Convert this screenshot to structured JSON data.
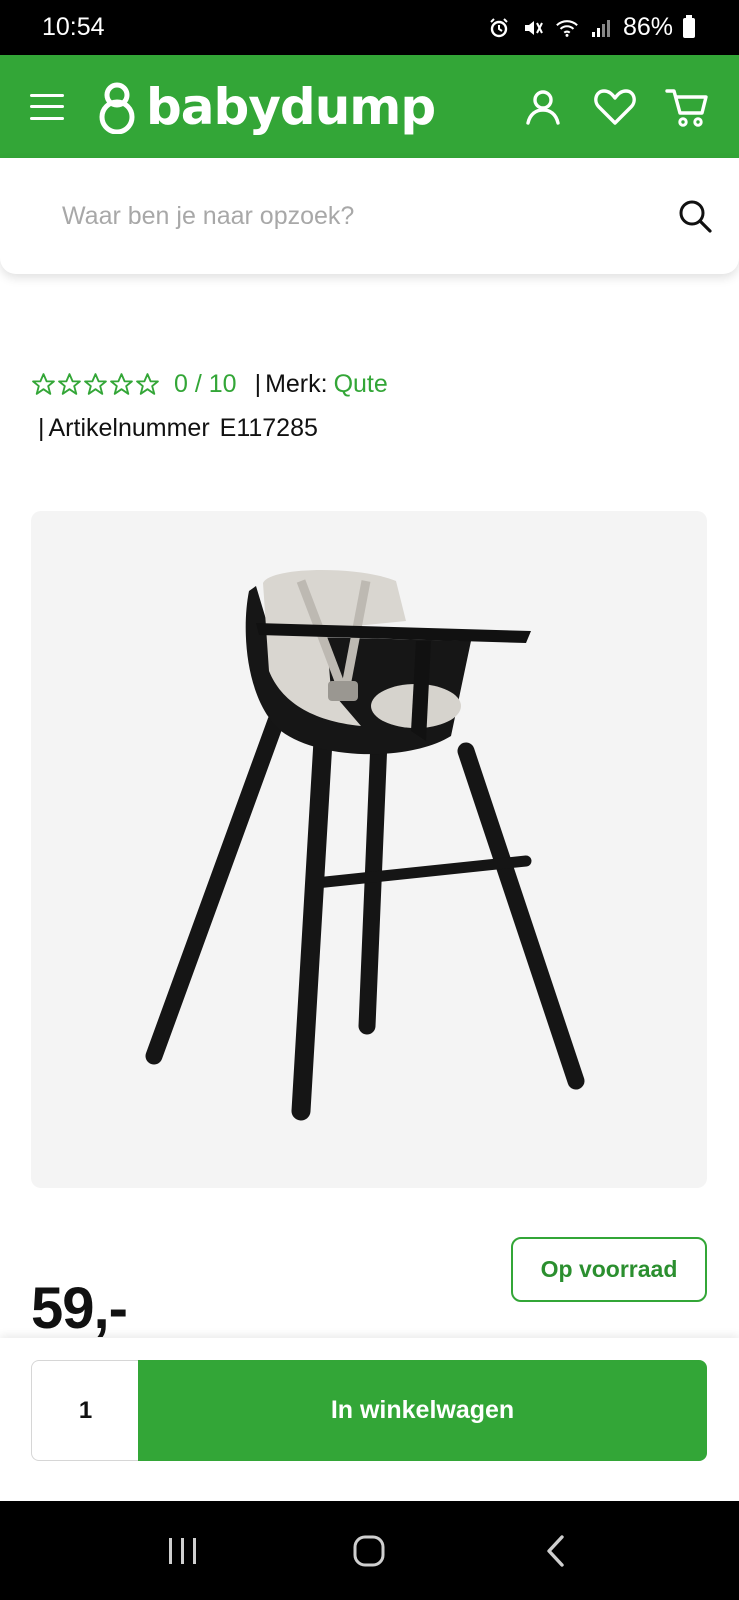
{
  "status_bar": {
    "time": "10:54",
    "battery": "86%",
    "icons": [
      "alarm-icon",
      "mute-icon",
      "wifi-icon",
      "signal-icon",
      "battery-icon"
    ]
  },
  "header": {
    "logo_text": "babydump",
    "menu_icon": "hamburger-icon",
    "actions": [
      "account-icon",
      "heart-icon",
      "cart-icon"
    ],
    "bg_color": "#33a637"
  },
  "search": {
    "placeholder": "Waar ben je naar opzoek?",
    "icon": "search-icon"
  },
  "product": {
    "rating": {
      "stars_filled": 0,
      "stars_total": 5,
      "score_text": "0 / 10"
    },
    "brand_label": "Merk:",
    "brand": "Qute",
    "article_label": "Artikelnummer",
    "article_number": "E117285",
    "stock_status": "Op voorraad",
    "price": "59,-"
  },
  "purchase": {
    "quantity": "1",
    "add_to_cart_label": "In winkelwagen"
  },
  "nav_bar": {
    "buttons": [
      "recent-apps-icon",
      "home-icon",
      "back-icon"
    ]
  },
  "colors": {
    "brand_green": "#33a637",
    "text": "#111111",
    "image_bg": "#f4f4f4"
  }
}
